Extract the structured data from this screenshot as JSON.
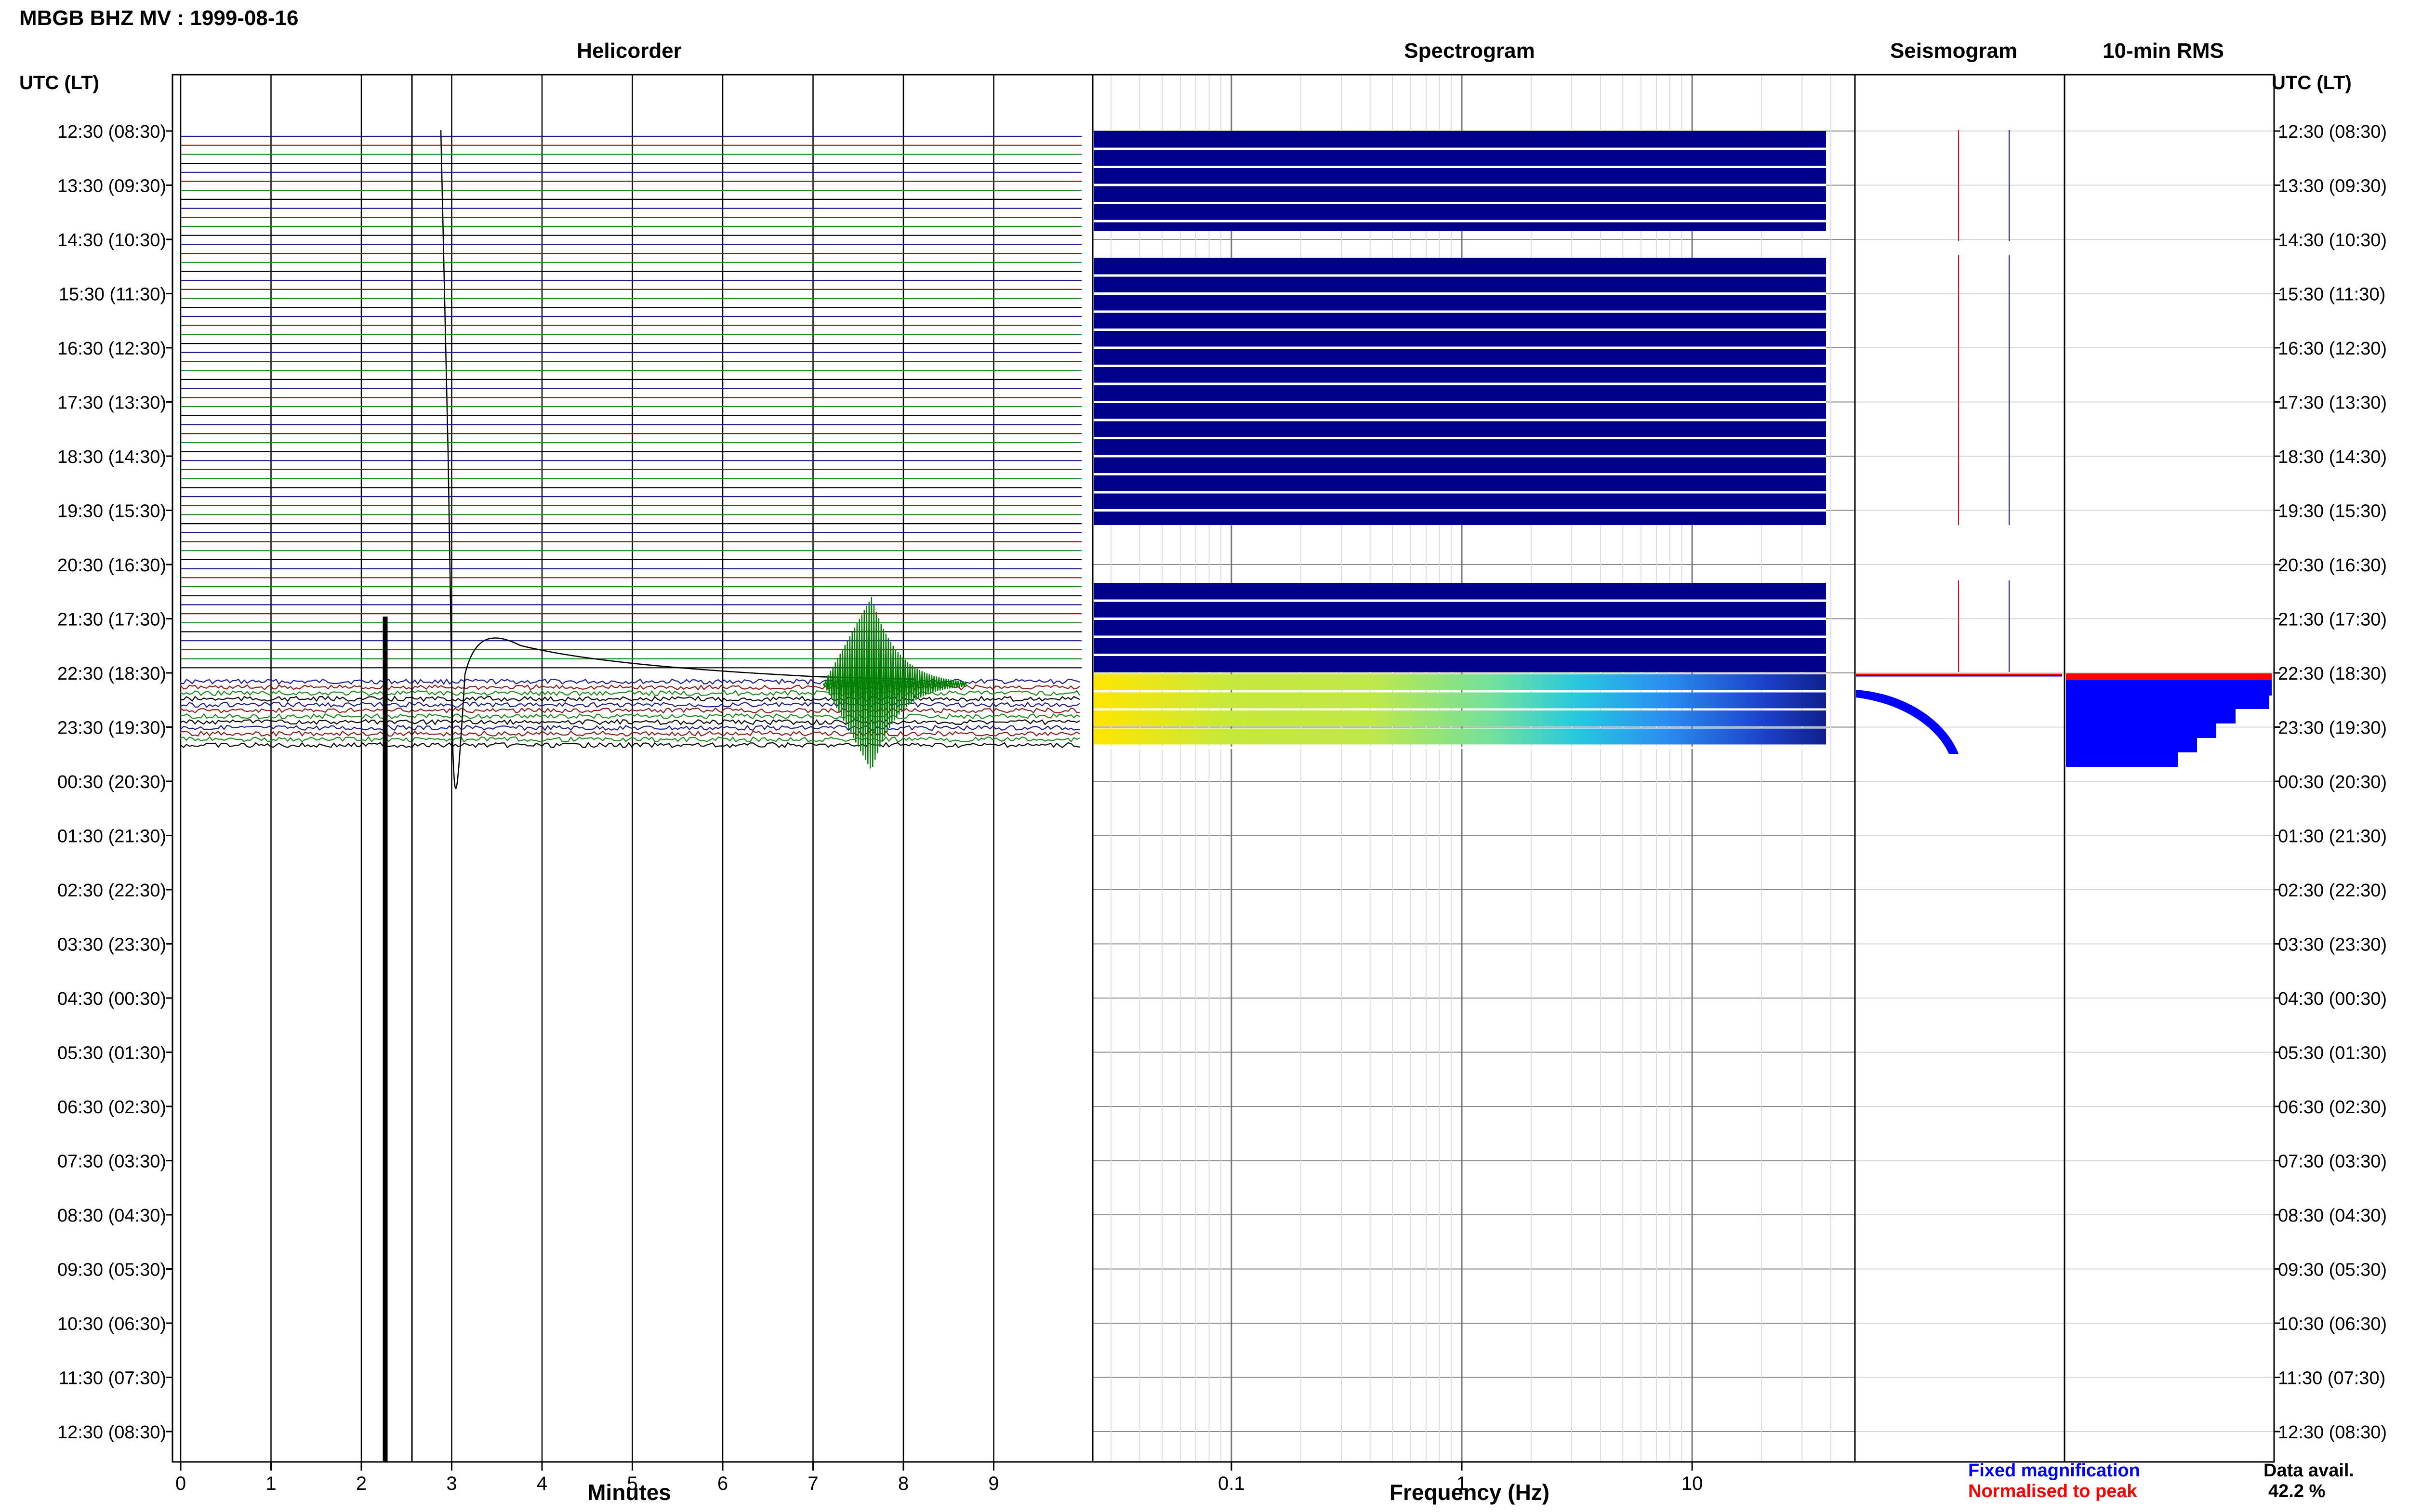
{
  "page": {
    "title": "MBGB BHZ MV : 1999-08-16",
    "left_axis_header": "UTC (LT)",
    "right_axis_header": "UTC (LT)"
  },
  "panels": {
    "helicorder": {
      "title": "Helicorder",
      "xlabel": "Minutes"
    },
    "spectrogram": {
      "title": "Spectrogram",
      "xlabel": "Frequency (Hz)"
    },
    "seismogram": {
      "title": "Seismogram"
    },
    "rms": {
      "title": "10-min RMS"
    }
  },
  "legend": {
    "fixed": "Fixed magnification",
    "normalised": "Normalised to peak",
    "fixed_color": "#0000ff",
    "normalised_color": "#ff0000"
  },
  "data_avail": {
    "label": "Data avail.",
    "value": "42.2 %"
  },
  "chart_data": [
    {
      "type": "line",
      "title": "Helicorder",
      "xlabel": "Minutes",
      "x_ticks": [
        "0",
        "1",
        "2",
        "3",
        "4",
        "5",
        "6",
        "7",
        "8",
        "9"
      ],
      "xlim": [
        0,
        10
      ],
      "y_ticks": [
        "12:30 (08:30)",
        "13:30 (09:30)",
        "14:30 (10:30)",
        "15:30 (11:30)",
        "16:30 (12:30)",
        "17:30 (13:30)",
        "18:30 (14:30)",
        "19:30 (15:30)",
        "20:30 (16:30)",
        "21:30 (17:30)",
        "22:30 (18:30)",
        "23:30 (19:30)",
        "00:30 (20:30)",
        "01:30 (21:30)",
        "02:30 (22:30)",
        "03:30 (23:30)",
        "04:30 (00:30)",
        "05:30 (01:30)",
        "06:30 (02:30)",
        "07:30 (03:30)",
        "08:30 (04:30)",
        "09:30 (05:30)",
        "10:30 (06:30)",
        "11:30 (07:30)",
        "12:30 (08:30)"
      ],
      "trace_colors": [
        "#1a1a8c",
        "#8c1a1a",
        "#1a8c1a",
        "#000000"
      ],
      "event_color": "#008000",
      "event_minute": 7.3
    },
    {
      "type": "heatmap",
      "title": "Spectrogram",
      "xlabel": "Frequency (Hz)",
      "scale": "log",
      "x_ticks": [
        "0.1",
        "1",
        "10"
      ],
      "xlim": [
        0.025,
        40
      ],
      "background_color": "#00008b"
    },
    {
      "type": "line",
      "title": "Seismogram",
      "series": [
        {
          "name": "Fixed magnification",
          "color": "#0000ff"
        },
        {
          "name": "Normalised to peak",
          "color": "#ff0000"
        }
      ]
    },
    {
      "type": "bar",
      "title": "10-min RMS",
      "colors": {
        "fixed": "#0000ff",
        "normalised": "#ff0000"
      }
    }
  ]
}
